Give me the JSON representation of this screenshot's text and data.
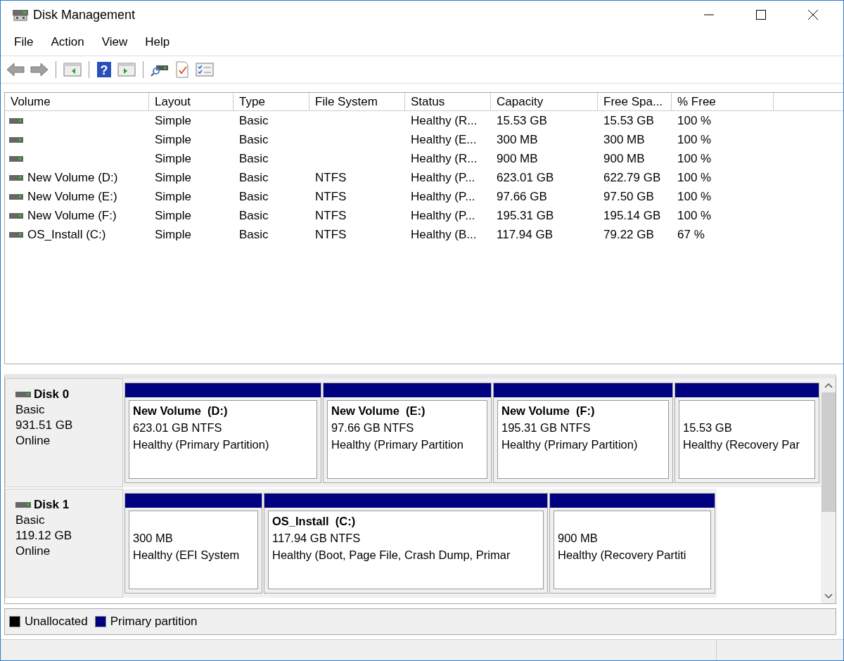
{
  "window": {
    "title": "Disk Management"
  },
  "menu": [
    "File",
    "Action",
    "View",
    "Help"
  ],
  "toolbar": {
    "help_glyph": "?"
  },
  "volume_list": {
    "columns": [
      "Volume",
      "Layout",
      "Type",
      "File System",
      "Status",
      "Capacity",
      "Free Spa...",
      "% Free"
    ],
    "rows": [
      {
        "layout": "Simple",
        "type": "Basic",
        "status": "Healthy (R...",
        "capacity": "15.53 GB",
        "free": "15.53 GB",
        "pct_free": "100 %"
      },
      {
        "layout": "Simple",
        "type": "Basic",
        "status": "Healthy (E...",
        "capacity": "300 MB",
        "free": "300 MB",
        "pct_free": "100 %"
      },
      {
        "layout": "Simple",
        "type": "Basic",
        "status": "Healthy (R...",
        "capacity": "900 MB",
        "free": "900 MB",
        "pct_free": "100 %"
      },
      {
        "volume": "New Volume (D:)",
        "layout": "Simple",
        "type": "Basic",
        "file_system": "NTFS",
        "status": "Healthy (P...",
        "capacity": "623.01 GB",
        "free": "622.79 GB",
        "pct_free": "100 %"
      },
      {
        "volume": "New Volume (E:)",
        "layout": "Simple",
        "type": "Basic",
        "file_system": "NTFS",
        "status": "Healthy (P...",
        "capacity": "97.66 GB",
        "free": "97.50 GB",
        "pct_free": "100 %"
      },
      {
        "volume": "New Volume (F:)",
        "layout": "Simple",
        "type": "Basic",
        "file_system": "NTFS",
        "status": "Healthy (P...",
        "capacity": "195.31 GB",
        "free": "195.14 GB",
        "pct_free": "100 %"
      },
      {
        "volume": "OS_Install (C:)",
        "layout": "Simple",
        "type": "Basic",
        "file_system": "NTFS",
        "status": "Healthy (B...",
        "capacity": "117.94 GB",
        "free": "79.22 GB",
        "pct_free": "67 %"
      }
    ]
  },
  "disks": [
    {
      "name": "Disk 0",
      "type": "Basic",
      "size": "931.51 GB",
      "status": "Online",
      "partitions": [
        {
          "title": "New Volume  (D:)",
          "size": "623.01 GB NTFS",
          "status": "Healthy (Primary Partition)"
        },
        {
          "title": "New Volume  (E:)",
          "size": "97.66 GB NTFS",
          "status": "Healthy (Primary Partition"
        },
        {
          "title": "New Volume  (F:)",
          "size": "195.31 GB NTFS",
          "status": "Healthy (Primary Partition)"
        },
        {
          "size": "15.53 GB",
          "status": "Healthy (Recovery Par"
        }
      ]
    },
    {
      "name": "Disk 1",
      "type": "Basic",
      "size": "119.12 GB",
      "status": "Online",
      "partitions": [
        {
          "size": "300 MB",
          "status": "Healthy (EFI System"
        },
        {
          "title": "OS_Install  (C:)",
          "size": "117.94 GB NTFS",
          "status": "Healthy (Boot, Page File, Crash Dump, Primar"
        },
        {
          "size": "900 MB",
          "status": "Healthy (Recovery Partiti"
        }
      ]
    }
  ],
  "legend": [
    {
      "label": "Unallocated",
      "color": "#000000"
    },
    {
      "label": "Primary partition",
      "color": "#000080"
    }
  ]
}
